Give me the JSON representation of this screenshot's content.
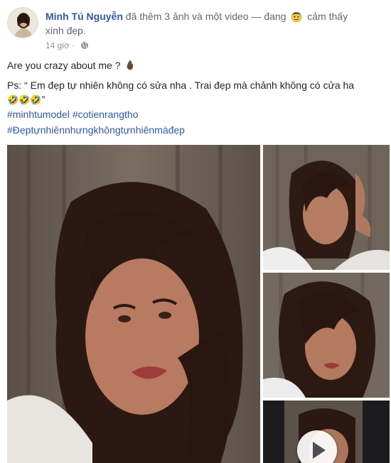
{
  "post": {
    "author": "Minh Tú Nguyễn",
    "action_text": "đã thêm 3 ảnh và một video — đang",
    "feeling_emoji": "smirking-face-emoji",
    "feeling_text": "cảm thấy",
    "feeling_text_2": "xinh đẹp.",
    "time": "14 giờ",
    "privacy_icon": "globe-icon",
    "dot": "·"
  },
  "content": {
    "line1": "Are you crazy about me ?",
    "line1_emoji": "eggplant-emoji",
    "line2": "Ps: “ Em đẹp tự nhiên không có sửa nha . Trai đẹp mà chảnh không có cửa ha",
    "line3_emojis": "🤣🤣🤣",
    "line3_quote": "”",
    "hashtags": [
      "#minhtumodel",
      "#cotienrangtho"
    ],
    "hashtag2": "#Đẹptựnhiênnhưngkhôngtựnhiênmàđẹp"
  },
  "media": {
    "items": [
      "photo",
      "photo",
      "photo",
      "video"
    ],
    "video_icon": "play-icon"
  },
  "colors": {
    "link": "#365899",
    "meta": "#90949c",
    "text": "#1d2129"
  }
}
